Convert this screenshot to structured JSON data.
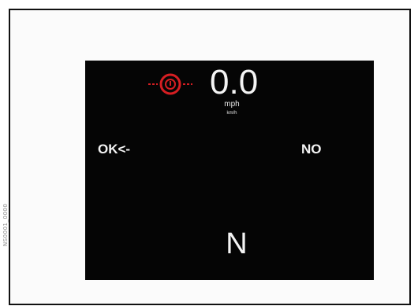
{
  "figure": {
    "side_caption": "NS0001_0000"
  },
  "display": {
    "warning_icon": "engine-warning-icon",
    "warning_color": "#d61e22",
    "speed": "0.0",
    "unit_primary": "mph",
    "unit_secondary": "km/h",
    "option_ok": "OK<-",
    "option_no": "NO",
    "gear": "N"
  }
}
